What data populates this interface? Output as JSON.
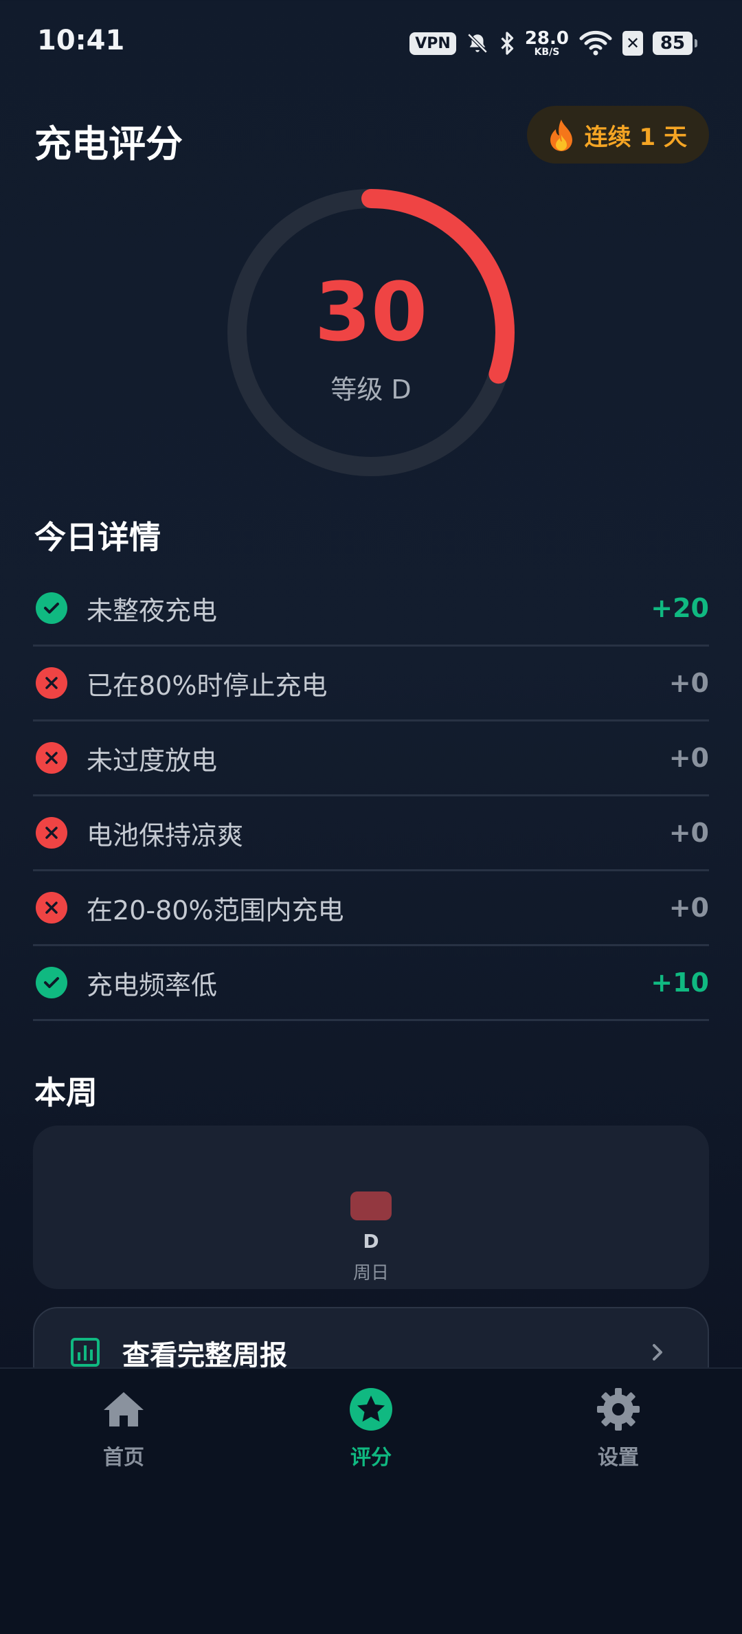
{
  "status_bar": {
    "time": "10:41",
    "vpn": "VPN",
    "net_speed_value": "28.0",
    "net_speed_unit": "KB/S",
    "sim_status": "✕",
    "battery": "85"
  },
  "header": {
    "title": "充电评分",
    "streak": "连续 1 天"
  },
  "score": {
    "value": "30",
    "grade": "等级 D",
    "progress": 0.3,
    "color": "#ef4444"
  },
  "today": {
    "title": "今日详情",
    "items": [
      {
        "label": "未整夜充电",
        "points": "+20",
        "passed": true
      },
      {
        "label": "已在80%时停止充电",
        "points": "+0",
        "passed": false
      },
      {
        "label": "未过度放电",
        "points": "+0",
        "passed": false
      },
      {
        "label": "电池保持凉爽",
        "points": "+0",
        "passed": false
      },
      {
        "label": "在20-80%范围内充电",
        "points": "+0",
        "passed": false
      },
      {
        "label": "充电频率低",
        "points": "+10",
        "passed": true
      }
    ]
  },
  "week": {
    "title": "本周",
    "grade": "D",
    "day": "周日"
  },
  "report": {
    "label": "查看完整周报"
  },
  "nav": {
    "home": "首页",
    "score": "评分",
    "settings": "设置"
  },
  "colors": {
    "accent_green": "#10b981",
    "danger_red": "#ef4444",
    "streak_orange": "#f5a524"
  }
}
